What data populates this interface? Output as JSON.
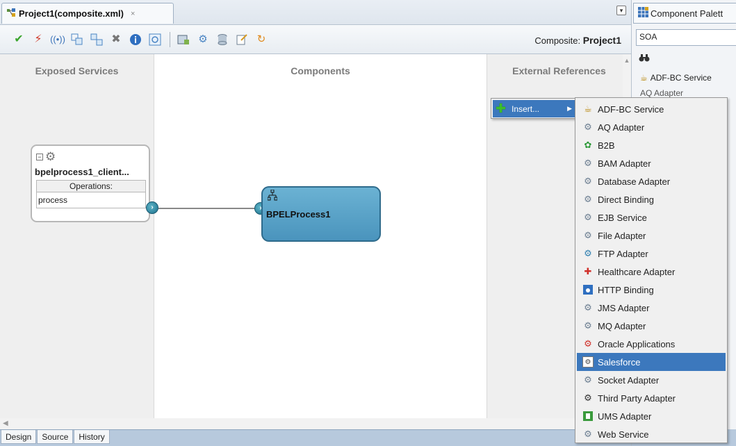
{
  "editor": {
    "tab_title": "Project1(composite.xml)",
    "tab_close": "×",
    "composite_label": "Composite:",
    "composite_name": "Project1"
  },
  "toolbar": {
    "icons": [
      "validate-check-icon",
      "lightning-icon",
      "broadcast-icon",
      "group-icon",
      "ungroup-icon",
      "delete-icon",
      "info-icon",
      "sync-icon",
      "test-icon",
      "configure-icon",
      "deploy-icon",
      "edit-icon",
      "refresh-icon"
    ]
  },
  "lanes": {
    "exposed": "Exposed Services",
    "components": "Components",
    "external": "External References"
  },
  "service": {
    "name": "bpelprocess1_client...",
    "operations_header": "Operations:",
    "operation": "process"
  },
  "bpel": {
    "name": "BPELProcess1"
  },
  "bottom_tabs": [
    "Design",
    "Source",
    "History"
  ],
  "palette": {
    "title": "Component Palett",
    "category": "SOA",
    "items": [
      "ADF-BC Service",
      "AQ Adapter"
    ]
  },
  "context_menu": {
    "insert": "Insert..."
  },
  "submenu": {
    "selected": "Salesforce",
    "items": [
      "ADF-BC Service",
      "AQ Adapter",
      "B2B",
      "BAM Adapter",
      "Database Adapter",
      "Direct Binding",
      "EJB Service",
      "File Adapter",
      "FTP Adapter",
      "Healthcare Adapter",
      "HTTP Binding",
      "JMS Adapter",
      "MQ Adapter",
      "Oracle Applications",
      "Salesforce",
      "Socket Adapter",
      "Third Party Adapter",
      "UMS Adapter",
      "Web Service"
    ]
  }
}
